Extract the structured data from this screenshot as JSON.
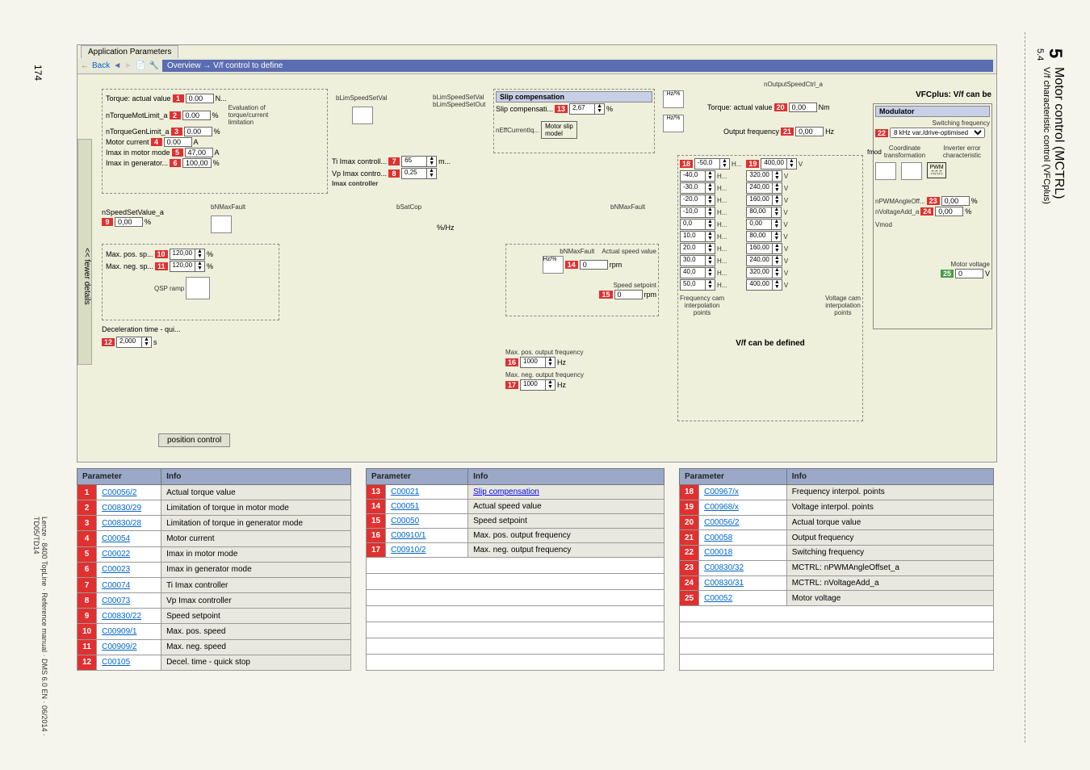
{
  "page_number": "174",
  "footer": "Lenze · 8400 TopLine · Reference manual · DMS 6.0 EN · 06/2014 · TD05/TD14",
  "chapter": {
    "num": "5",
    "title": "Motor control (MCTRL)",
    "sub_num": "5.4",
    "sub_title": "V/f characteristic control (VFCplus)"
  },
  "app": {
    "tab": "Application Parameters",
    "back": "Back",
    "breadcrumb": "Overview → V/f control to define"
  },
  "sidebar_label": "<< fewer details",
  "left_block": {
    "torque_actual": {
      "label": "Torque: actual value",
      "marker": "1",
      "val": "0.00",
      "unit": "N..."
    },
    "ntorque_mot": {
      "label": "nTorqueMotLimit_a",
      "marker": "2",
      "val": "0.00",
      "unit": "%"
    },
    "ntorque_gen": {
      "label": "nTorqueGenLimit_a",
      "marker": "3",
      "val": "0.00",
      "unit": "%"
    },
    "motor_current": {
      "label": "Motor current",
      "marker": "4",
      "val": "0.00",
      "unit": "A"
    },
    "imax_motor": {
      "label": "Imax in motor mode",
      "marker": "5",
      "val": "47,00",
      "unit": "A"
    },
    "imax_gen": {
      "label": "Imax in generator...",
      "marker": "6",
      "val": "100,00",
      "unit": "%"
    },
    "eval_text": "Evaluation of\ntorque/current\nlimitation",
    "ti_imax": {
      "label": "Ti Imax controll...",
      "marker": "7",
      "val": "65",
      "unit": "m..."
    },
    "vp_imax": {
      "label": "Vp Imax contro...",
      "marker": "8",
      "val": "0,25"
    },
    "imax_controller": "Imax controller"
  },
  "speed_block": {
    "nspeed": {
      "label": "nSpeedSetValue_a",
      "marker": "9",
      "val": "0,00",
      "unit": "%"
    },
    "blimspeed": "bLimSpeedSetVal",
    "blimspeed2": "bLimSpeedSetVal\nbLimSpeedSetOut",
    "bnmax": "bNMaxFault",
    "bsatcop": "bSatCop",
    "max_pos": {
      "label": "Max. pos. sp...",
      "marker": "10",
      "val": "120,00",
      "unit": "%"
    },
    "max_neg": {
      "label": "Max. neg. sp...",
      "marker": "11",
      "val": "120,00",
      "unit": "%"
    },
    "qsp": "QSP ramp",
    "decel": {
      "label": "Deceleration time - qui...",
      "marker": "12",
      "val": "2,000",
      "unit": "s"
    },
    "pos_ctrl": "position control",
    "hz_pct": "%/Hz"
  },
  "slip_block": {
    "title": "Slip compensation",
    "slip_comp": {
      "label": "Slip compensati...",
      "marker": "13",
      "val": "2,67",
      "unit": "%"
    },
    "neffcurrent": "nEffCurrentIq...",
    "motor_slip": "Motor slip\nmodel",
    "hz_pct": "Hz/%",
    "bnmaxfault": "bNMaxFault",
    "actual_speed": {
      "label": "Actual speed value",
      "marker": "14",
      "val": "0",
      "unit": "rpm"
    },
    "speed_setpoint": {
      "label": "Speed setpoint",
      "marker": "15",
      "val": "0",
      "unit": "rpm"
    },
    "max_pos_out": {
      "label": "Max. pos. output frequency",
      "marker": "16",
      "val": "1000",
      "unit": "Hz"
    },
    "max_neg_out": {
      "label": "Max. neg. output frequency",
      "marker": "17",
      "val": "1000",
      "unit": "Hz"
    }
  },
  "right_block": {
    "noutputspeed": "nOutputSpeedCtrl_a",
    "torque_actual": {
      "label": "Torque: actual value",
      "marker": "20",
      "val": "0,00",
      "unit": "Nm"
    },
    "output_freq": {
      "label": "Output frequency",
      "marker": "21",
      "val": "0,00",
      "unit": "Hz"
    },
    "freq_col": {
      "marker": "18",
      "vals": [
        "-50,0",
        "-40,0",
        "-30,0",
        "-20,0",
        "-10,0",
        "0,0",
        "10,0",
        "20,0",
        "30,0",
        "40,0",
        "50,0"
      ],
      "unit": "H..."
    },
    "volt_col": {
      "marker": "19",
      "vals": [
        "400,00",
        "320,00",
        "240,00",
        "160,00",
        "80,00",
        "0,00",
        "80,00",
        "160,00",
        "240,00",
        "320,00",
        "400,00"
      ],
      "unit": "V"
    },
    "freq_cam": "Frequency cam\ninterpolation\npoints",
    "volt_cam": "Voltage cam\ninterpolation\npoints",
    "vf_defined": "V/f can be defined"
  },
  "modulator": {
    "vfcplus": "VFCplus: V/f can be",
    "title": "Modulator",
    "sw_freq": "Switching frequency",
    "sw_val": {
      "marker": "22",
      "val": "8 kHz var./drive-optimised"
    },
    "fmod": "fmod",
    "coord": "Coordinate\ntransformation",
    "inverter": "Inverter error\ncharacteristic",
    "pwm": "PWM",
    "npwm_angle": {
      "label": "nPWMAngleOff...",
      "marker": "23",
      "val": "0,00",
      "unit": "%"
    },
    "nvoltage_add": {
      "label": "nVoltageAdd_a",
      "marker": "24",
      "val": "0,00",
      "unit": "%"
    },
    "vmod": "Vmod",
    "motor_voltage": {
      "label": "Motor voltage",
      "marker": "25",
      "val": "0",
      "unit": "V"
    }
  },
  "table1": {
    "headers": [
      "Parameter",
      "Info"
    ],
    "rows": [
      {
        "n": "1",
        "p": "C00056/2",
        "i": "Actual torque value"
      },
      {
        "n": "2",
        "p": "C00830/29",
        "i": "Limitation of torque in motor mode"
      },
      {
        "n": "3",
        "p": "C00830/28",
        "i": "Limitation of torque in generator mode"
      },
      {
        "n": "4",
        "p": "C00054",
        "i": "Motor current"
      },
      {
        "n": "5",
        "p": "C00022",
        "i": "Imax in motor mode"
      },
      {
        "n": "6",
        "p": "C00023",
        "i": "Imax in generator mode"
      },
      {
        "n": "7",
        "p": "C00074",
        "i": "Ti Imax controller"
      },
      {
        "n": "8",
        "p": "C00073",
        "i": "Vp Imax controller"
      },
      {
        "n": "9",
        "p": "C00830/22",
        "i": "Speed setpoint"
      },
      {
        "n": "10",
        "p": "C00909/1",
        "i": "Max. pos. speed"
      },
      {
        "n": "11",
        "p": "C00909/2",
        "i": "Max. neg. speed"
      },
      {
        "n": "12",
        "p": "C00105",
        "i": "Decel. time - quick stop"
      }
    ]
  },
  "table2": {
    "headers": [
      "Parameter",
      "Info"
    ],
    "rows": [
      {
        "n": "13",
        "p": "C00021",
        "i": "Slip compensation",
        "link_info": true
      },
      {
        "n": "14",
        "p": "C00051",
        "i": "Actual speed value"
      },
      {
        "n": "15",
        "p": "C00050",
        "i": "Speed setpoint"
      },
      {
        "n": "16",
        "p": "C00910/1",
        "i": "Max. pos. output frequency"
      },
      {
        "n": "17",
        "p": "C00910/2",
        "i": "Max. neg. output frequency"
      }
    ],
    "empty_rows": 7
  },
  "table3": {
    "headers": [
      "Parameter",
      "Info"
    ],
    "rows": [
      {
        "n": "18",
        "p": "C00967/x",
        "i": "Frequency interpol. points"
      },
      {
        "n": "19",
        "p": "C00968/x",
        "i": "Voltage interpol. points"
      },
      {
        "n": "20",
        "p": "C00056/2",
        "i": "Actual torque value"
      },
      {
        "n": "21",
        "p": "C00058",
        "i": "Output frequency"
      },
      {
        "n": "22",
        "p": "C00018",
        "i": "Switching frequency"
      },
      {
        "n": "23",
        "p": "C00830/32",
        "i": "MCTRL: nPWMAngleOffset_a"
      },
      {
        "n": "24",
        "p": "C00830/31",
        "i": "MCTRL: nVoltageAdd_a"
      },
      {
        "n": "25",
        "p": "C00052",
        "i": "Motor voltage"
      }
    ],
    "empty_rows": 4
  }
}
